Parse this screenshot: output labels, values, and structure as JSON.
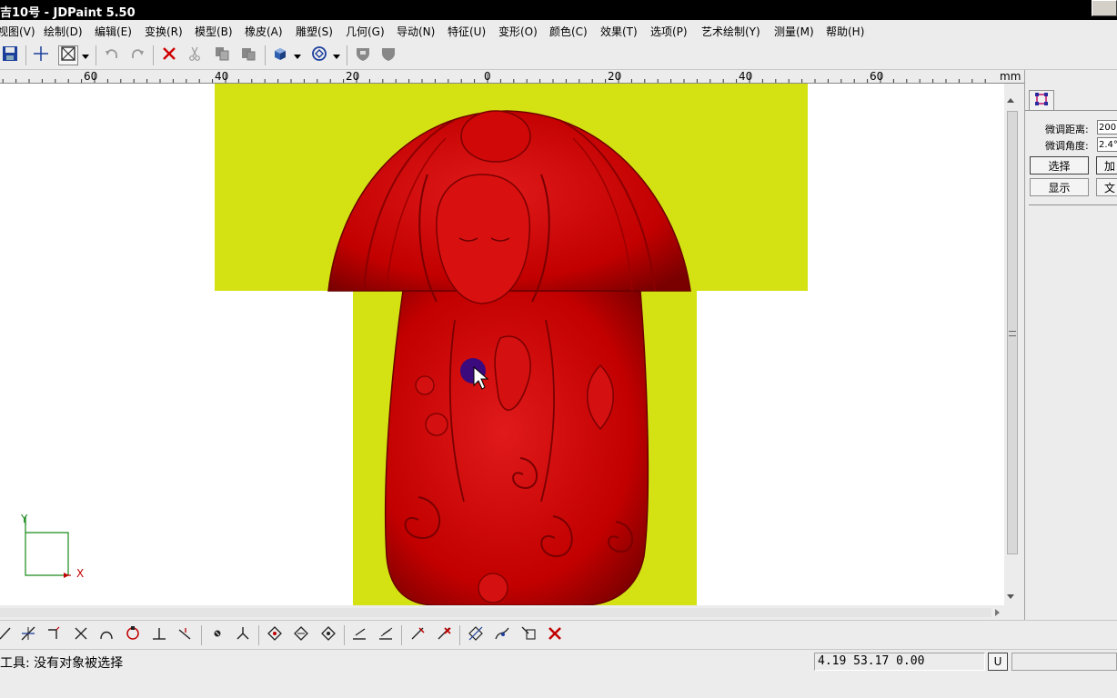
{
  "window": {
    "title": "吉10号 - JDPaint 5.50"
  },
  "menu": [
    {
      "label": "视图(V)"
    },
    {
      "label": "绘制(D)"
    },
    {
      "label": "编辑(E)"
    },
    {
      "label": "变换(R)"
    },
    {
      "label": "模型(B)"
    },
    {
      "label": "橡皮(A)"
    },
    {
      "label": "雕塑(S)"
    },
    {
      "label": "几何(G)"
    },
    {
      "label": "导动(N)"
    },
    {
      "label": "特征(U)"
    },
    {
      "label": "变形(O)"
    },
    {
      "label": "颜色(C)"
    },
    {
      "label": "效果(T)"
    },
    {
      "label": "选项(P)"
    },
    {
      "label": "艺术绘制(Y)"
    },
    {
      "label": "测量(M)"
    },
    {
      "label": "帮助(H)"
    }
  ],
  "ruler": {
    "labels": [
      {
        "value": -60,
        "text": "60"
      },
      {
        "value": -40,
        "text": "40"
      },
      {
        "value": -20,
        "text": "20"
      },
      {
        "value": 0,
        "text": "0"
      },
      {
        "value": 20,
        "text": "20"
      },
      {
        "value": 40,
        "text": "40"
      },
      {
        "value": 60,
        "text": "60"
      }
    ],
    "unit": "mm"
  },
  "axis": {
    "x": "X",
    "y": "Y"
  },
  "colors": {
    "background_material": "#d4e214",
    "relief": "#c00000",
    "cursor": "#2a0a8a"
  },
  "panel": {
    "dist_label": "微调距离:",
    "dist_value": "200",
    "angle_label": "微调角度:",
    "angle_value": "2.4°",
    "select_button": "选择",
    "show_button": "显示",
    "btn_a": "加",
    "btn_b": "文"
  },
  "status": {
    "message": "工具: 没有对象被选择",
    "coords": "4.19 53.17 0.00",
    "unit_button": "U"
  }
}
